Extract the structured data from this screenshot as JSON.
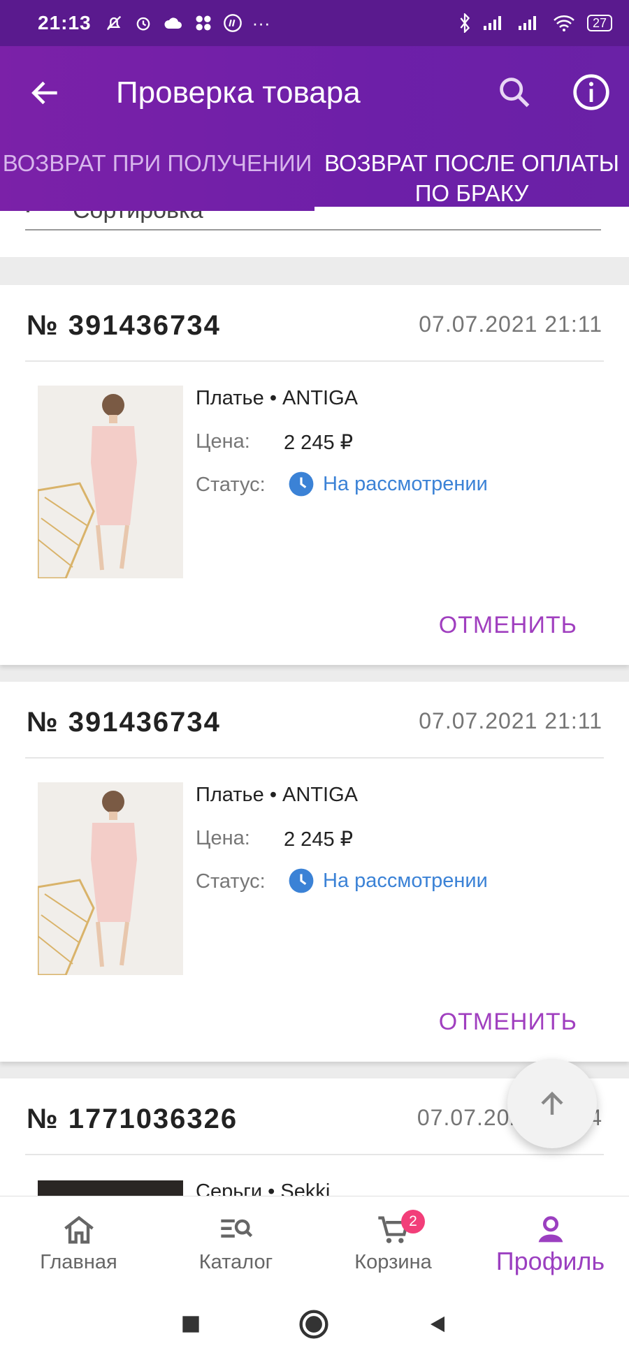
{
  "status_bar": {
    "time": "21:13",
    "battery": "27"
  },
  "app_bar": {
    "title": "Проверка товара"
  },
  "tabs": [
    {
      "label": "Возврат при получении",
      "active": false
    },
    {
      "label": "Возврат после оплаты по браку",
      "active": true
    }
  ],
  "sort": {
    "label": "Сортировка"
  },
  "orders": [
    {
      "number": "№ 391436734",
      "date": "07.07.2021 21:11",
      "product": "Платье • ANTIGA",
      "price_label": "Цена:",
      "price": "2 245 ₽",
      "status_label": "Статус:",
      "status": "На рассмотрении",
      "cancel_label": "ОТМЕНИТЬ"
    },
    {
      "number": "№ 391436734",
      "date": "07.07.2021 21:11",
      "product": "Платье • ANTIGA",
      "price_label": "Цена:",
      "price": "2 245 ₽",
      "status_label": "Статус:",
      "status": "На рассмотрении",
      "cancel_label": "ОТМЕНИТЬ"
    },
    {
      "number": "№ 1771036326",
      "date": "07.07.2021 21:14",
      "product": "Серьги • Sekki"
    }
  ],
  "bottom_nav": [
    {
      "label": "Главная",
      "icon": "home-icon"
    },
    {
      "label": "Каталог",
      "icon": "catalog-search-icon"
    },
    {
      "label": "Корзина",
      "icon": "cart-icon",
      "badge": "2"
    },
    {
      "label": "Профиль",
      "icon": "profile-icon",
      "active": true
    }
  ],
  "colors": {
    "primary": "#6d1fa8",
    "accent": "#a03fbf",
    "status_blue": "#3b82d6",
    "badge": "#f23e79"
  }
}
